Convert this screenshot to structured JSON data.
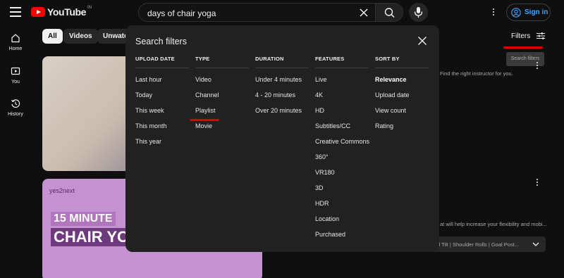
{
  "header": {
    "logo_text": "YouTube",
    "country_code": "IN",
    "search_value": "days of chair yoga",
    "signin_label": "Sign in"
  },
  "nav": [
    {
      "label": "Home",
      "icon": "home-icon"
    },
    {
      "label": "You",
      "icon": "you-icon"
    },
    {
      "label": "History",
      "icon": "history-icon"
    }
  ],
  "chips": [
    "All",
    "Videos",
    "Unwatch"
  ],
  "filters_button": "Filters",
  "tooltip": "Search filters",
  "results": {
    "snippet1": "Find the right instructor for you.",
    "video2_channel": "yes2next",
    "video2_title_line1": "15 MINUTE",
    "video2_title_line2": "CHAIR YO",
    "snippet2": "at will help increase your flexibility and mobi...",
    "chapters_text": "d Tilt | Shoulder Rolls | Goal Post..."
  },
  "modal": {
    "title": "Search filters",
    "columns": [
      {
        "heading": "UPLOAD DATE",
        "options": [
          "Last hour",
          "Today",
          "This week",
          "This month",
          "This year"
        ]
      },
      {
        "heading": "TYPE",
        "options": [
          "Video",
          "Channel",
          "Playlist",
          "Movie"
        ]
      },
      {
        "heading": "DURATION",
        "options": [
          "Under 4 minutes",
          "4 - 20 minutes",
          "Over 20 minutes"
        ]
      },
      {
        "heading": "FEATURES",
        "options": [
          "Live",
          "4K",
          "HD",
          "Subtitles/CC",
          "Creative Commons",
          "360°",
          "VR180",
          "3D",
          "HDR",
          "Location",
          "Purchased"
        ]
      },
      {
        "heading": "SORT BY",
        "options": [
          "Relevance",
          "Upload date",
          "View count",
          "Rating"
        ],
        "selected": "Relevance"
      }
    ]
  },
  "colors": {
    "accent_red": "#e00000",
    "link_blue": "#3ea6ff",
    "background": "#0f0f0f",
    "modal": "#212121"
  }
}
